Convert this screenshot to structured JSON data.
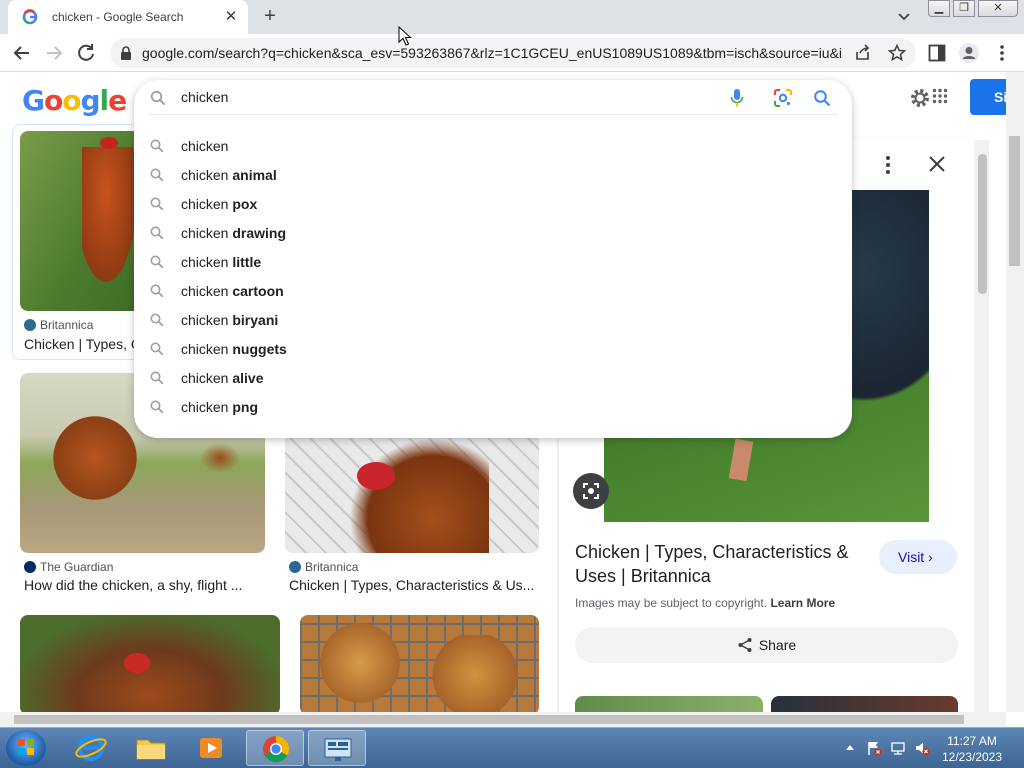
{
  "browser": {
    "tab_title": "chicken - Google Search",
    "url": "google.com/search?q=chicken&sca_esv=593263867&rlz=1C1GCEU_enUS1089US1089&tbm=isch&source=iu&i..."
  },
  "header": {
    "logo_letters": [
      "G",
      "o",
      "o",
      "g",
      "l",
      "e"
    ],
    "signin_label": "Si"
  },
  "search": {
    "query": "chicken",
    "suggestions": [
      {
        "prefix": "chicken",
        "suffix": ""
      },
      {
        "prefix": "chicken",
        "suffix": "animal"
      },
      {
        "prefix": "chicken",
        "suffix": "pox"
      },
      {
        "prefix": "chicken",
        "suffix": "drawing"
      },
      {
        "prefix": "chicken",
        "suffix": "little"
      },
      {
        "prefix": "chicken",
        "suffix": "cartoon"
      },
      {
        "prefix": "chicken",
        "suffix": "biryani"
      },
      {
        "prefix": "chicken",
        "suffix": "nuggets"
      },
      {
        "prefix": "chicken",
        "suffix": "alive"
      },
      {
        "prefix": "chicken",
        "suffix": "png"
      }
    ]
  },
  "results": [
    {
      "source": "Britannica",
      "title": "Chicken | Types, C",
      "icon": "britannica-icon"
    },
    {
      "source": "The Guardian",
      "title": "How did the chicken, a shy, flight ...",
      "icon": "guardian-icon"
    },
    {
      "source": "Britannica",
      "title": "Chicken | Types, Characteristics & Us...",
      "icon": "britannica-icon"
    }
  ],
  "panel": {
    "title": "Chicken | Types, Characteristics & Uses | Britannica",
    "visit_label": "Visit",
    "copyright_text": "Images may be subject to copyright.",
    "learn_more": "Learn More",
    "share_label": "Share"
  },
  "taskbar": {
    "time": "11:27 AM",
    "date": "12/23/2023"
  },
  "colors": {
    "accent": "#1a73e8",
    "taskbar": "#3d6593"
  }
}
